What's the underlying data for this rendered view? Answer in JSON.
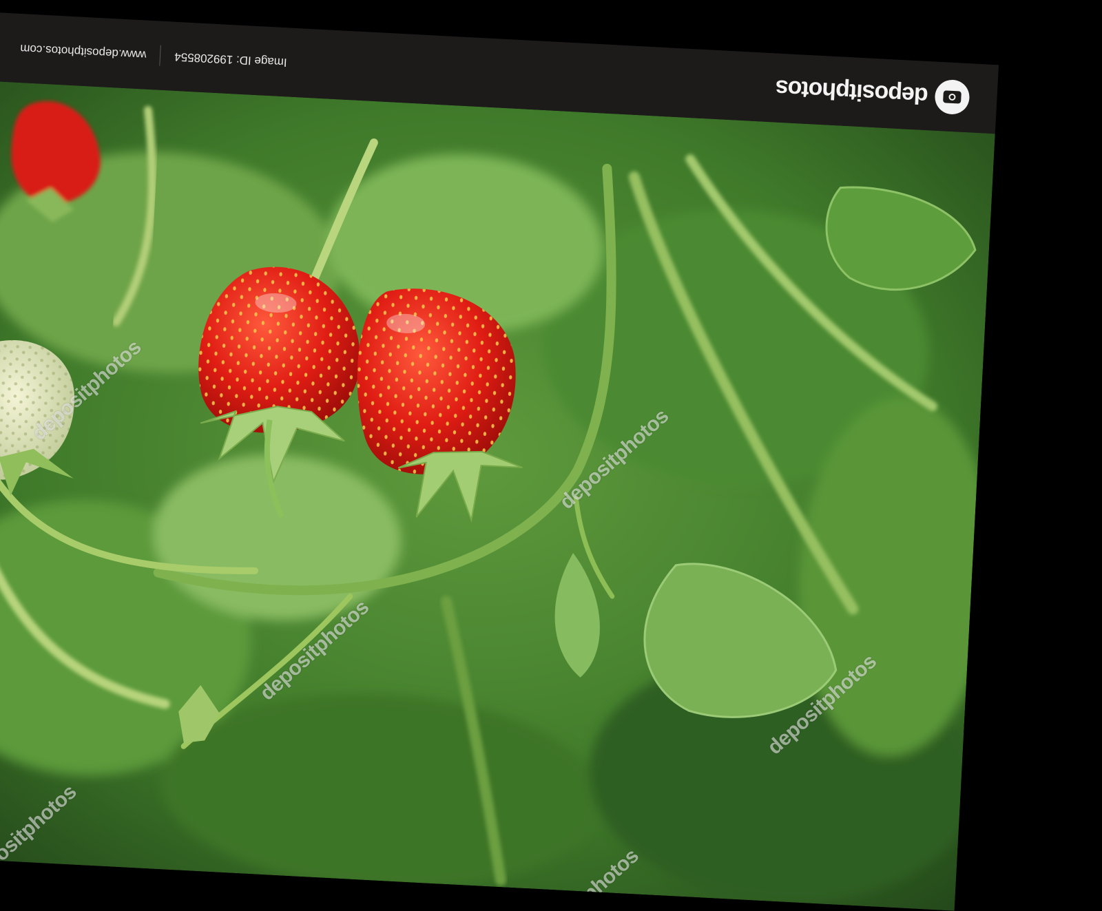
{
  "brand": {
    "logo_text": "depositphotos"
  },
  "info_bar": {
    "image_id": "Image ID: 199208554",
    "site_url": "www.depositphotos.com"
  },
  "watermark_text": "depositphotos",
  "colors": {
    "background": "#000000",
    "bar": "#1d1a1a",
    "strawberry_red": "#e8231b",
    "foliage_green": "#4e8a32"
  },
  "photo_subject": "strawberries"
}
